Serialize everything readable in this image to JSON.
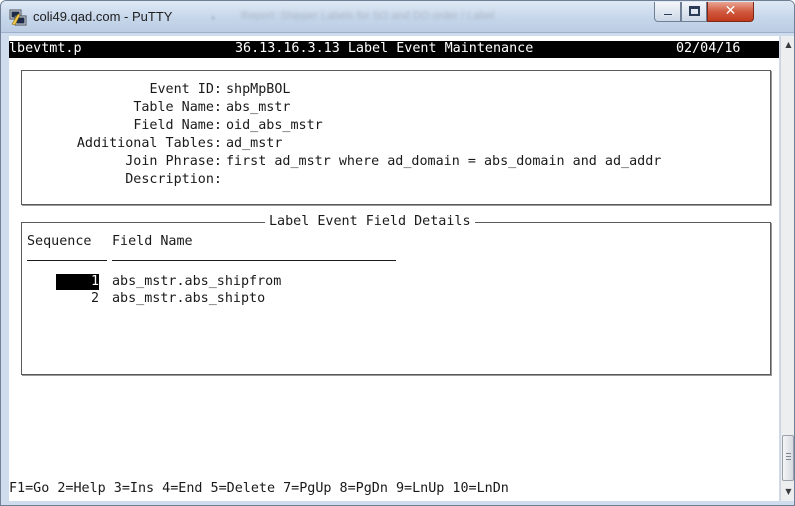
{
  "window": {
    "title": "coli49.qad.com - PuTTY",
    "background_tab_title": "Report: Shipper Labels for SO and DO order / Label",
    "buttons": {
      "minimize": "minimize-icon",
      "maximize": "maximize-icon",
      "close": "close-icon"
    }
  },
  "header": {
    "program": "lbevtmt.p",
    "title": "36.13.16.3.13 Label Event Maintenance",
    "date": "02/04/16"
  },
  "event": {
    "fields": [
      {
        "label": "Event ID:",
        "value": "shpMpBOL"
      },
      {
        "label": "Table Name:",
        "value": "abs_mstr"
      },
      {
        "label": "Field Name:",
        "value": "oid_abs_mstr"
      },
      {
        "label": "Additional Tables:",
        "value": "ad_mstr"
      },
      {
        "label": "Join Phrase:",
        "value": "first ad_mstr where ad_domain = abs_domain and ad_addr"
      },
      {
        "label": "Description:",
        "value": ""
      }
    ]
  },
  "details": {
    "caption": "Label Event Field Details",
    "col_sequence": "Sequence",
    "col_field_name": "Field Name",
    "rows": [
      {
        "sequence": "1",
        "field": "abs_mstr.abs_shipfrom",
        "selected": true
      },
      {
        "sequence": "2",
        "field": "abs_mstr.abs_shipto",
        "selected": false
      }
    ]
  },
  "function_keys": "F1=Go 2=Help 3=Ins 4=End 5=Delete 7=PgUp 8=PgDn 9=LnUp 10=LnDn",
  "scrollbar": {
    "up": "scroll-up-icon",
    "down": "scroll-down-icon"
  },
  "colors": {
    "terminal_bg": "#ffffff",
    "terminal_fg": "#1a1a1a",
    "statusbar_bg": "#000000",
    "close_btn": "#c1391d"
  }
}
